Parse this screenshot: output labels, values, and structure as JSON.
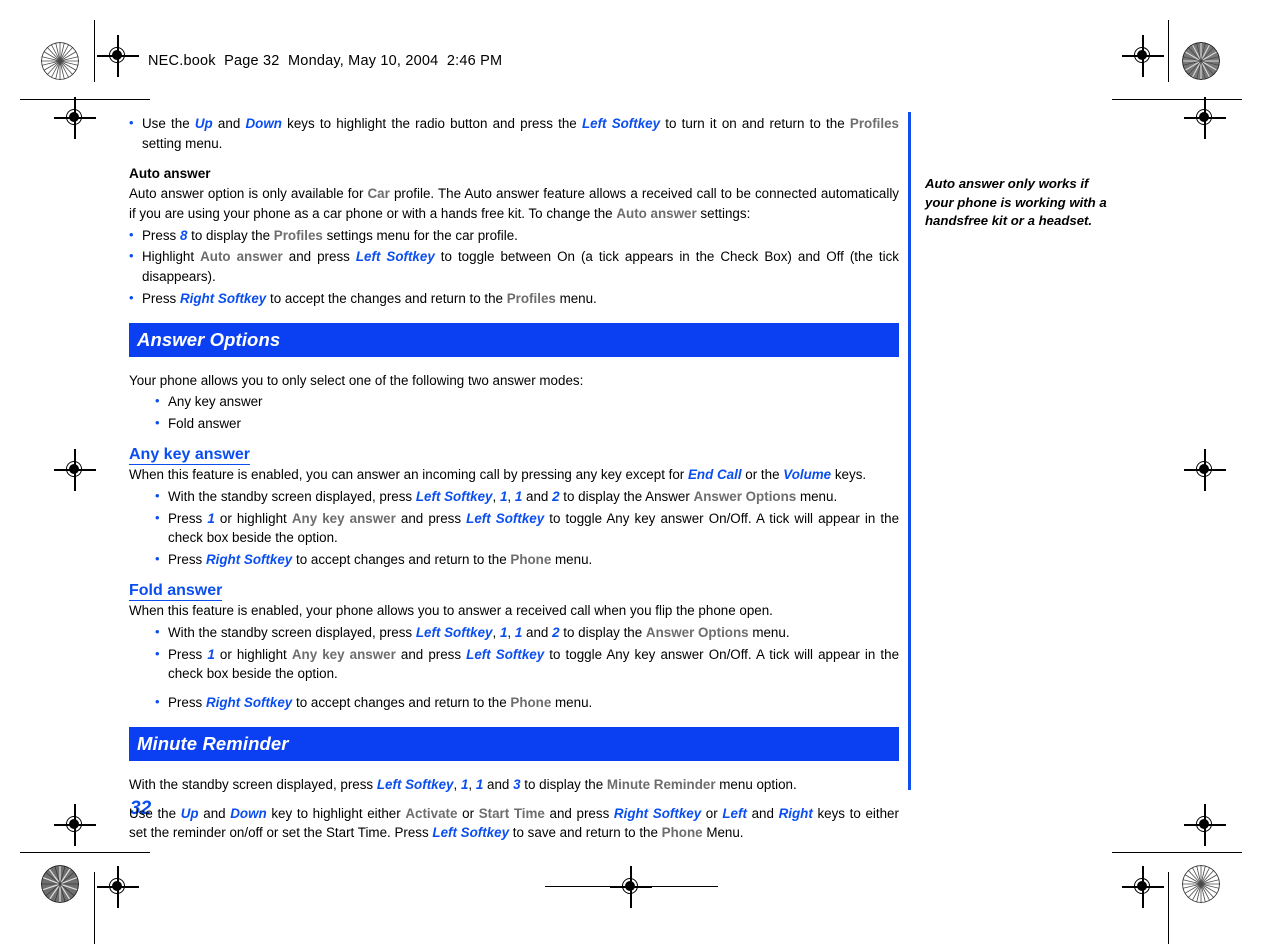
{
  "page": {
    "header": "NEC.book  Page 32  Monday, May 10, 2004  2:46 PM",
    "number": "32",
    "accent_blue": "#0a4ef0",
    "bar_blue": "#0a40f2",
    "keyword_gray": "#6d6d6d"
  },
  "sidenote": {
    "text": "Auto answer only works if your phone is working with a handsfree kit or a headset."
  },
  "content": {
    "intro_bullet": {
      "p1": "Use the ",
      "k1": "Up",
      "p2": " and ",
      "k2": "Down",
      "p3": " keys to highlight the radio button and press the ",
      "k3": "Left Softkey",
      "p4": " to turn it on and return to the ",
      "k4": "Profiles",
      "p5": " setting menu."
    },
    "auto_answer": {
      "heading": "Auto answer",
      "para": {
        "p1": "Auto answer option is only available for ",
        "k1": "Car",
        "p2": " profile. The Auto answer feature allows a received call to be connected automatically if you are using your phone as a car phone or with a hands free kit. To change the ",
        "k2": "Auto answer",
        "p3": " settings:"
      },
      "bullets": [
        {
          "p1": "Press ",
          "k1": "8",
          "p2": " to display the ",
          "k2": "Profiles",
          "p3": " settings menu for the car profile."
        },
        {
          "p1": "Highlight ",
          "k1": "Auto answer",
          "p2": " and press ",
          "k2": "Left Softkey",
          "p3": " to toggle between On (a tick appears in the Check Box) and Off (the tick disappears)."
        },
        {
          "p1": "Press ",
          "k1": "Right Softkey",
          "p2": " to accept the changes and return to the ",
          "k2": "Profiles",
          "p3": " menu."
        }
      ]
    },
    "answer_options": {
      "bar_title": "Answer Options",
      "intro": "Your phone allows you to only select one of the following two answer modes:",
      "modes": [
        "Any key answer",
        "Fold answer"
      ],
      "any_key": {
        "heading": "Any key answer",
        "para": {
          "p1": "When this feature is enabled, you can answer an incoming call by pressing any key except for ",
          "k1": "End Call",
          "p2": " or the ",
          "k2": "Volume",
          "p3": " keys."
        },
        "bullets": [
          {
            "p1": "With the standby screen displayed, press ",
            "k1": "Left Softkey",
            "p2": ", ",
            "k2": "1",
            "p3": ", ",
            "k3": "1",
            "p4": " and ",
            "k4": "2",
            "p5": " to display the Answer ",
            "k5": "Answer Options",
            "p6": " menu."
          },
          {
            "p1": "Press ",
            "k1": "1",
            "p2": " or highlight ",
            "k2": "Any key answer",
            "p3": " and press ",
            "k3": "Left Softkey",
            "p4": " to toggle Any key answer On/Off. A tick will appear in the check box beside the option."
          },
          {
            "p1": "Press ",
            "k1": "Right Softkey",
            "p2": " to accept changes and return to the ",
            "k2": "Phone",
            "p3": " menu."
          }
        ]
      },
      "fold": {
        "heading": "Fold answer",
        "para": "When this feature is enabled, your phone allows you to answer a received call when you flip the phone open.",
        "bullets": [
          {
            "p1": "With the standby screen displayed, press ",
            "k1": "Left Softkey",
            "p2": ", ",
            "k2": "1",
            "p3": ", ",
            "k3": "1",
            "p4": " and ",
            "k4": "2",
            "p5": " to display the ",
            "k5": "Answer Options",
            "p6": " menu."
          },
          {
            "p1": "Press ",
            "k1": "1",
            "p2": " or highlight ",
            "k2": "Any key answer",
            "p3": " and press ",
            "k3": "Left Softkey",
            "p4": " to toggle Any key answer On/Off. A tick will appear in the check box beside the option."
          },
          {
            "p1": "Press ",
            "k1": "Right Softkey",
            "p2": " to accept changes and return to the ",
            "k2": "Phone",
            "p3": " menu."
          }
        ]
      }
    },
    "minute_reminder": {
      "bar_title": "Minute Reminder",
      "para1": {
        "p1": "With the standby screen displayed, press ",
        "k1": "Left Softkey",
        "p2": ", ",
        "k2": "1",
        "p3": ", ",
        "k3": "1",
        "p4": " and ",
        "k4": "3",
        "p5": " to display the ",
        "k5": "Minute Reminder",
        "p6": " menu option."
      },
      "para2": {
        "p1": "Use the ",
        "k1": "Up",
        "p2": " and ",
        "k2": "Down",
        "p3": " key to highlight either ",
        "k3": "Activate",
        "p4": " or  ",
        "k4": "Start Time",
        "p5": " and press ",
        "k5": "Right Softkey",
        "p6": " or ",
        "k6": "Left",
        "p7": " and ",
        "k7": "Right",
        "p8": " keys to either set the reminder on/off or set the Start Time. Press ",
        "k8": "Left Softkey",
        "p9": " to save and return to the ",
        "k9": "Phone",
        "p10": " Menu."
      }
    }
  }
}
